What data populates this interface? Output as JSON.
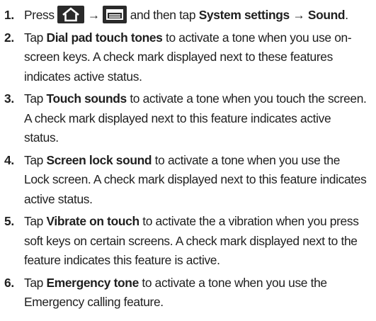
{
  "steps": [
    {
      "num": "1.",
      "press": "Press",
      "home_icon": "home-key-icon",
      "arrow1": "→",
      "menu_icon": "menu-key-icon",
      "then_tap": "and then tap",
      "system_settings": "System settings",
      "arrow2": "→",
      "sound": "Sound",
      "end": "."
    },
    {
      "num": "2.",
      "tap": "Tap",
      "bold": "Dial pad touch tones",
      "rest": "to activate a tone when you use on-screen keys. A check mark displayed next to these features indicates active status."
    },
    {
      "num": "3.",
      "tap": "Tap",
      "bold": "Touch sounds",
      "rest": "to activate a tone when you touch the screen. A check mark displayed next to this feature indicates active status."
    },
    {
      "num": "4.",
      "tap": "Tap",
      "bold": "Screen lock sound",
      "rest": "to activate a tone when you use the Lock screen. A check mark displayed next to this feature indicates active status."
    },
    {
      "num": "5.",
      "tap": "Tap",
      "bold": "Vibrate on touch",
      "rest": "to activate the a vibration when you press soft keys on certain screens. A check mark displayed next to the feature indicates this feature is active."
    },
    {
      "num": "6.",
      "tap": "Tap",
      "bold": "Emergency tone",
      "rest": "to activate a tone when you use the Emergency calling feature."
    }
  ]
}
